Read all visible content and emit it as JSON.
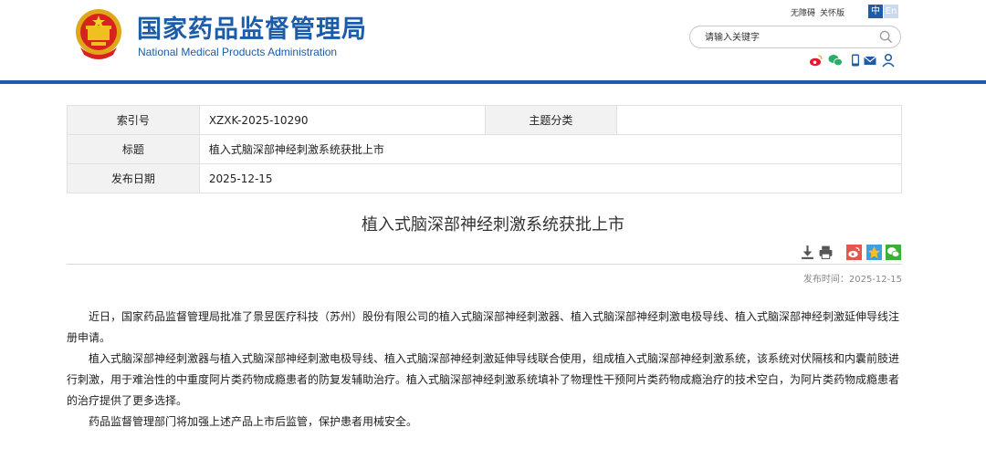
{
  "header": {
    "title_cn": "国家药品监督管理局",
    "title_en": "National Medical Products Administration",
    "top_links": [
      "无障碍",
      "关怀版"
    ],
    "lang_zh": "中",
    "lang_en": "En",
    "search": {
      "placeholder": "请输入关键字"
    },
    "social_icons": [
      "weibo-icon",
      "wechat-icon",
      "mobile-icon",
      "mail-icon",
      "user-icon"
    ],
    "accent_color": "#1c5ca8"
  },
  "info": {
    "index_label": "索引号",
    "index_value": "XZXK-2025-10290",
    "topic_label": "主题分类",
    "topic_value": "",
    "title_label": "标题",
    "title_value": "植入式脑深部神经刺激系统获批上市",
    "date_label": "发布日期",
    "date_value": "2025-12-15"
  },
  "article": {
    "title": "植入式脑深部神经刺激系统获批上市",
    "tool_icons": [
      "download-icon",
      "print-icon",
      "weibo-share-icon",
      "qzone-share-icon",
      "wechat-share-icon"
    ],
    "publish_time": "发布时间：2025-12-15",
    "paragraphs": [
      "近日，国家药品监督管理局批准了景昱医疗科技（苏州）股份有限公司的植入式脑深部神经刺激器、植入式脑深部神经刺激电极导线、植入式脑深部神经刺激延伸导线注册申请。",
      "植入式脑深部神经刺激器与植入式脑深部神经刺激电极导线、植入式脑深部神经刺激延伸导线联合使用，组成植入式脑深部神经刺激系统，该系统对伏隔核和内囊前肢进行刺激，用于难治性的中重度阿片类药物成瘾患者的防复发辅助治疗。植入式脑深部神经刺激系统填补了物理性干预阿片类药物成瘾治疗的技术空白，为阿片类药物成瘾患者的治疗提供了更多选择。",
      "药品监督管理部门将加强上述产品上市后监管，保护患者用械安全。"
    ]
  }
}
